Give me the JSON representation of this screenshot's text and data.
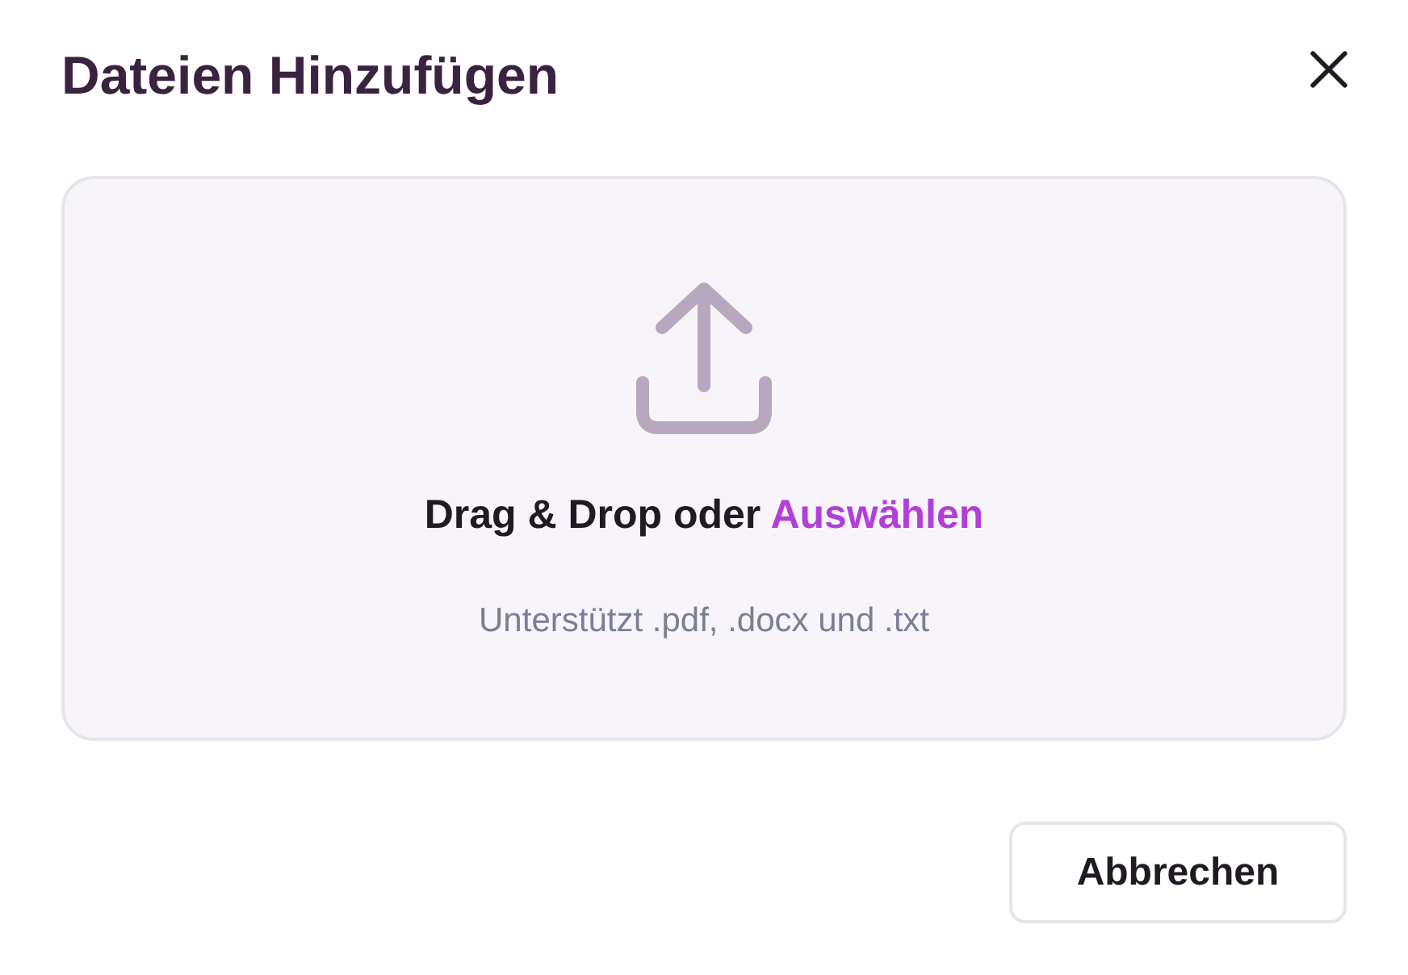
{
  "dialog": {
    "title": "Dateien Hinzufügen"
  },
  "dropzone": {
    "prompt": "Drag & Drop oder",
    "link": "Auswählen",
    "hint": "Unterstützt .pdf, .docx und .txt"
  },
  "buttons": [
    "Abbrechen"
  ]
}
